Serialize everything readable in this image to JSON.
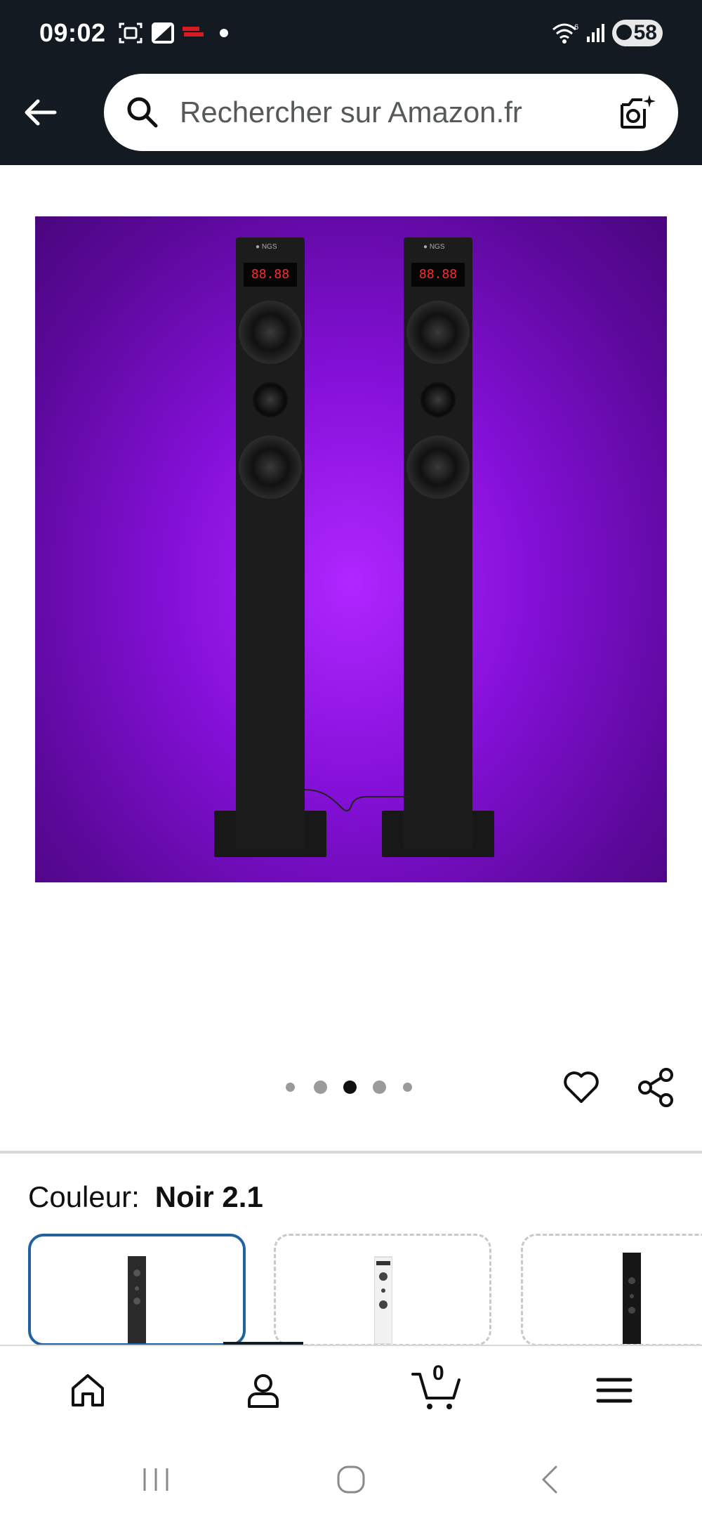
{
  "status_bar": {
    "time": "09:02",
    "battery": "58",
    "icons": [
      "screenshot-icon",
      "app-icon",
      "notification-app-icon",
      "dot-icon",
      "wifi-icon",
      "signal-icon",
      "battery-icon"
    ]
  },
  "header": {
    "back_icon": "arrow-left-icon",
    "search": {
      "placeholder": "Rechercher sur Amazon.fr",
      "value": ""
    },
    "camera_icon": "camera-search-icon"
  },
  "gallery": {
    "image_alt": "NGS sound tower speakers, pair, purple background",
    "dots_total": 5,
    "active_dot": 3,
    "wishlist_icon": "heart-icon",
    "share_icon": "share-icon",
    "tower_display_text": "88.88"
  },
  "variation": {
    "label": "Couleur:",
    "value": "Noir 2.1",
    "options": [
      {
        "name": "Noir 2.1",
        "selected": true,
        "color": "#222222"
      },
      {
        "name": "Blanc",
        "selected": false,
        "color": "#f2f2f2"
      },
      {
        "name": "Noir",
        "selected": false,
        "color": "#111111"
      }
    ]
  },
  "bottom_nav": {
    "items": [
      {
        "name": "home",
        "icon": "home-icon"
      },
      {
        "name": "account",
        "icon": "user-icon"
      },
      {
        "name": "cart",
        "icon": "cart-icon",
        "count": "0"
      },
      {
        "name": "menu",
        "icon": "hamburger-menu-icon"
      }
    ],
    "active_index": 1
  },
  "system_nav": {
    "items": [
      "recent-apps-icon",
      "home-circle-icon",
      "back-chevron-icon"
    ]
  },
  "colors": {
    "header_bg": "#131a22",
    "selected_border": "#2162a1",
    "image_bg": "#8410d8"
  }
}
